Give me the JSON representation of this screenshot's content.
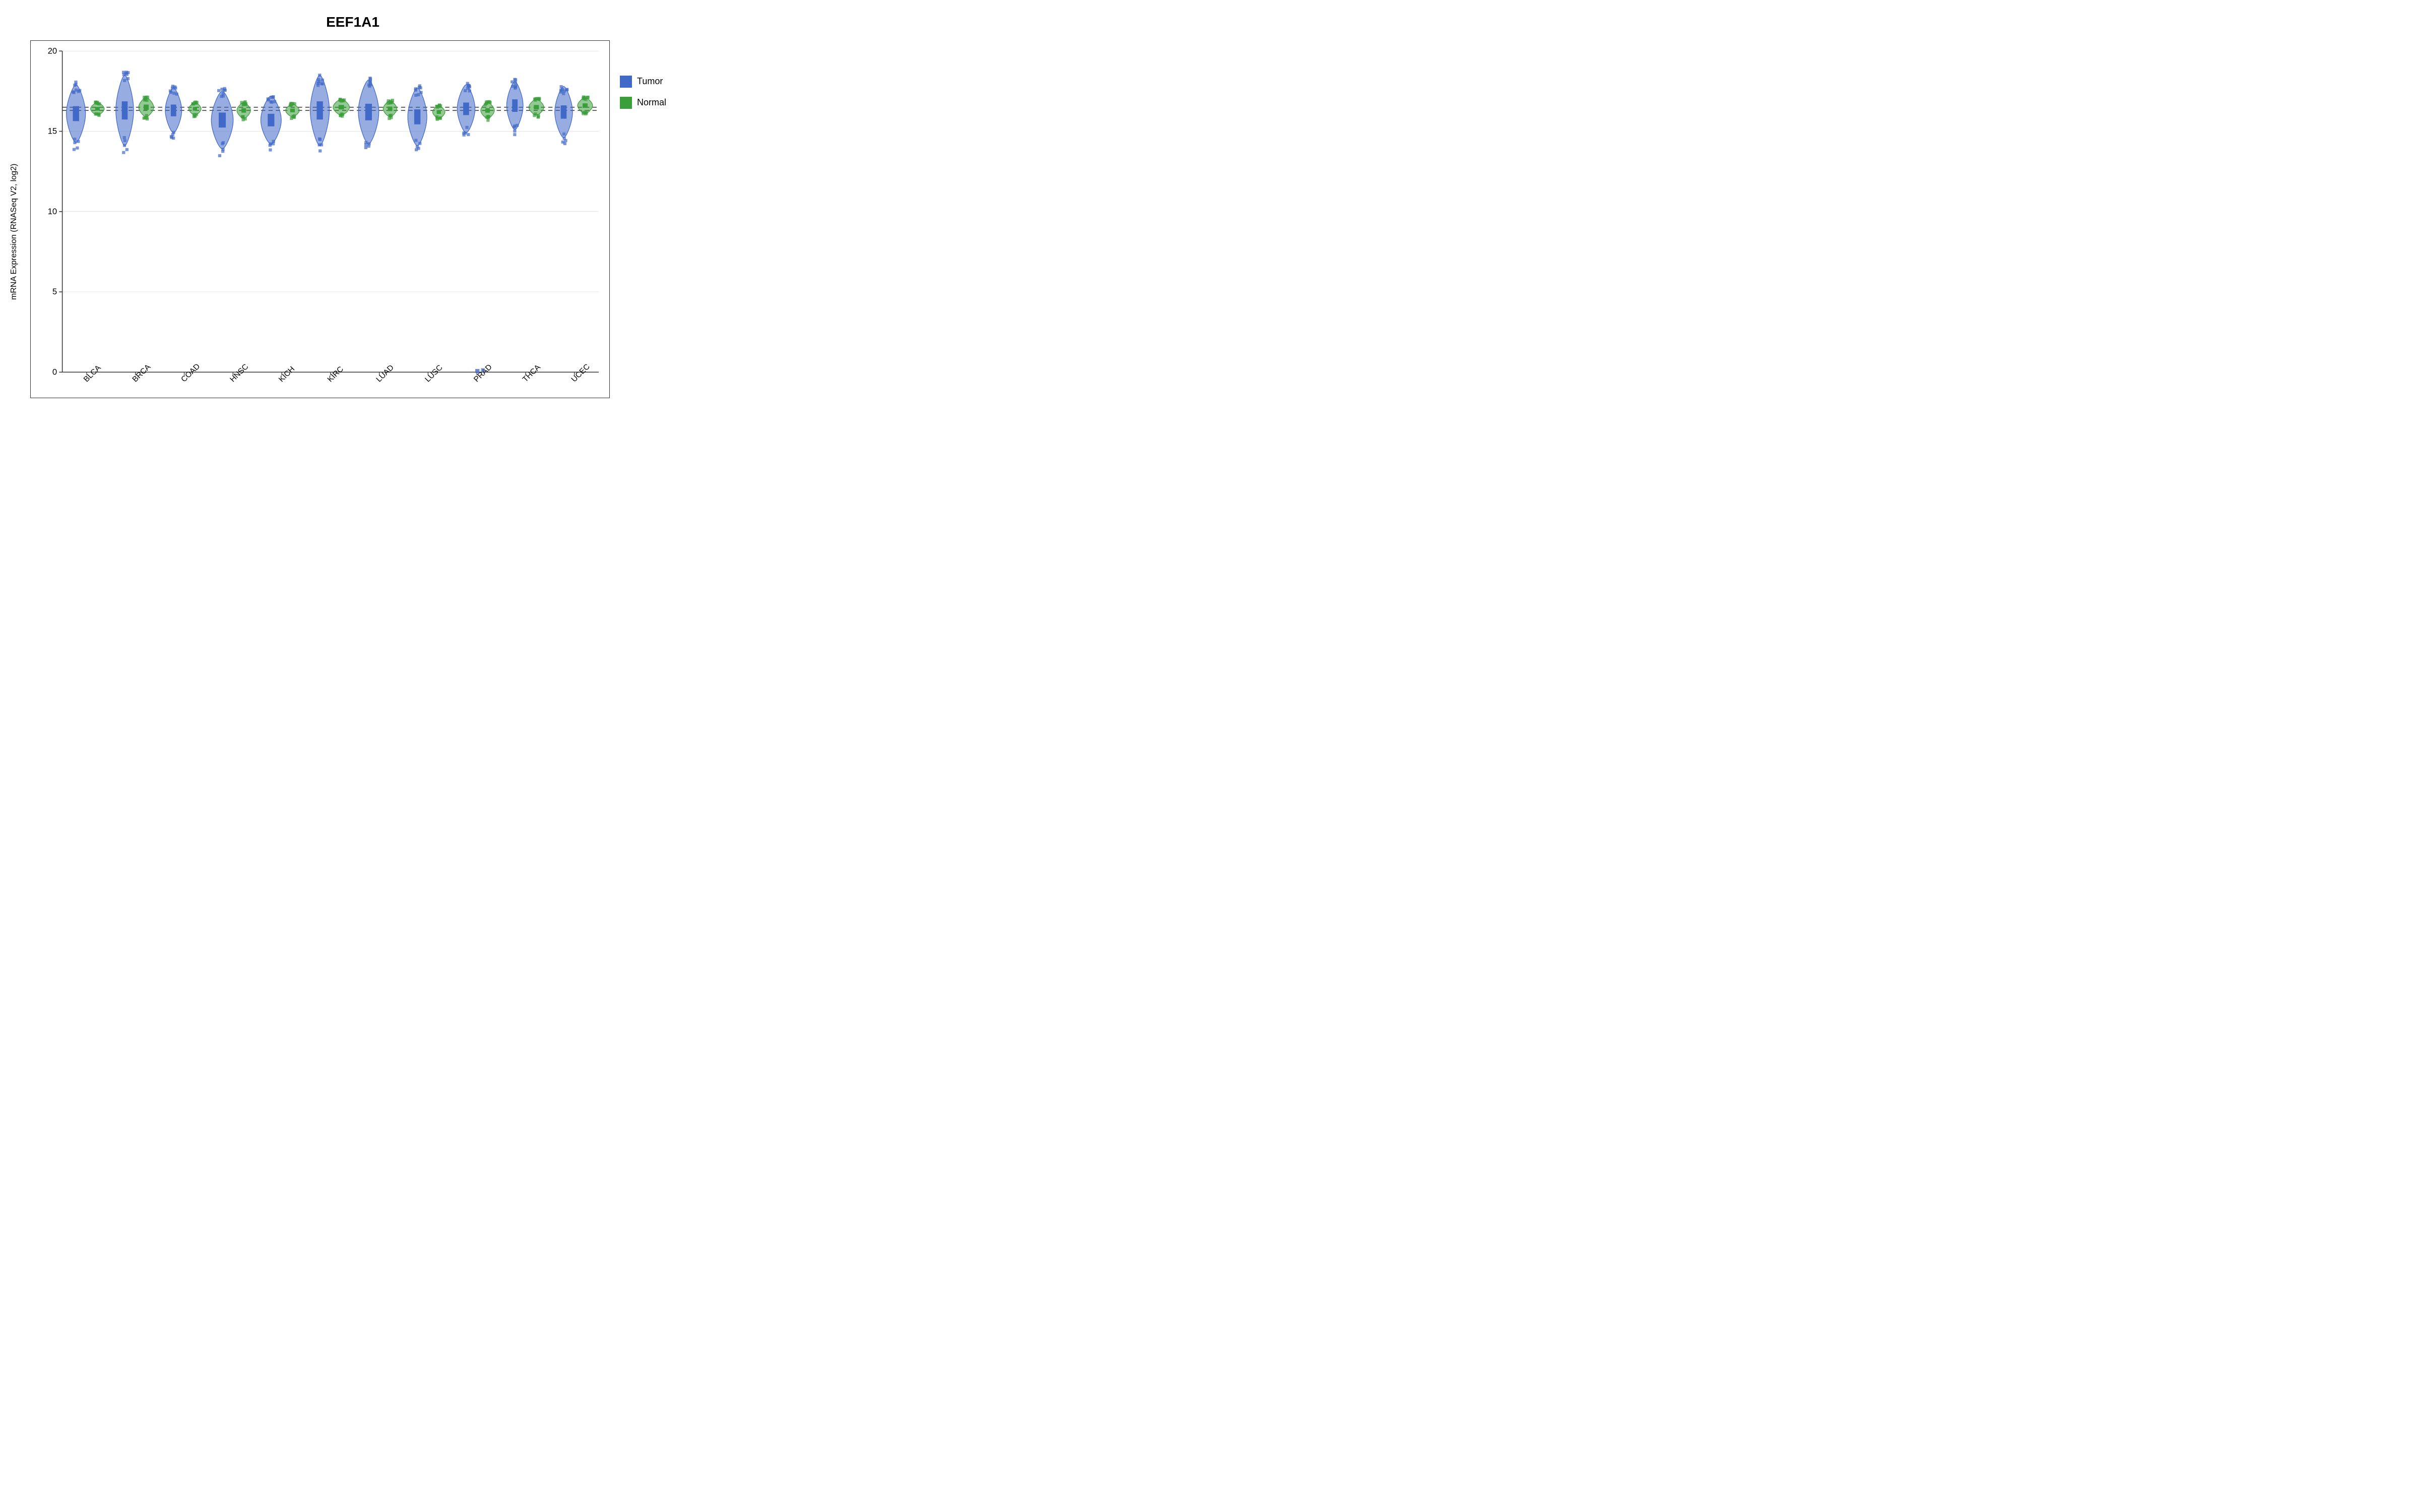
{
  "title": "EEF1A1",
  "yAxisLabel": "mRNA Expression (RNASeq V2, log2)",
  "legend": {
    "items": [
      {
        "label": "Tumor",
        "color": "#4169c8",
        "id": "tumor"
      },
      {
        "label": "Normal",
        "color": "#3a9e3a",
        "id": "normal"
      }
    ]
  },
  "yAxis": {
    "min": 0,
    "max": 20,
    "ticks": [
      0,
      5,
      10,
      15,
      20
    ],
    "labels": [
      "0",
      "5",
      "10",
      "15",
      "20"
    ]
  },
  "cancerTypes": [
    "BLCA",
    "BRCA",
    "COAD",
    "HNSC",
    "KICH",
    "KIRC",
    "LUAD",
    "LUSC",
    "PRAD",
    "THCA",
    "UCEC"
  ],
  "referenceLine1": 16.3,
  "referenceLine2": 16.5,
  "violins": [
    {
      "cancer": "BLCA",
      "tumorCenter": 16.1,
      "tumorWidth": 0.7,
      "tumorSpread": 1.8,
      "normalCenter": 16.4,
      "normalWidth": 0.5,
      "normalSpread": 0.4
    },
    {
      "cancer": "BRCA",
      "tumorCenter": 16.3,
      "tumorWidth": 0.65,
      "tumorSpread": 2.2,
      "normalCenter": 16.5,
      "normalWidth": 0.55,
      "normalSpread": 0.6
    },
    {
      "cancer": "COAD",
      "tumorCenter": 16.3,
      "tumorWidth": 0.6,
      "tumorSpread": 1.4,
      "normalCenter": 16.4,
      "normalWidth": 0.45,
      "normalSpread": 0.4
    },
    {
      "cancer": "HNSC",
      "tumorCenter": 15.7,
      "tumorWidth": 0.8,
      "tumorSpread": 1.8,
      "normalCenter": 16.3,
      "normalWidth": 0.5,
      "normalSpread": 0.5
    },
    {
      "cancer": "KICH",
      "tumorCenter": 15.7,
      "tumorWidth": 0.75,
      "tumorSpread": 1.5,
      "normalCenter": 16.3,
      "normalWidth": 0.5,
      "normalSpread": 0.4
    },
    {
      "cancer": "KIRC",
      "tumorCenter": 16.3,
      "tumorWidth": 0.7,
      "tumorSpread": 2.2,
      "normalCenter": 16.5,
      "normalWidth": 0.6,
      "normalSpread": 0.5
    },
    {
      "cancer": "LUAD",
      "tumorCenter": 16.2,
      "tumorWidth": 0.75,
      "tumorSpread": 2.0,
      "normalCenter": 16.4,
      "normalWidth": 0.5,
      "normalSpread": 0.5
    },
    {
      "cancer": "LUSC",
      "tumorCenter": 15.9,
      "tumorWidth": 0.7,
      "tumorSpread": 1.8,
      "normalCenter": 16.2,
      "normalWidth": 0.45,
      "normalSpread": 0.4
    },
    {
      "cancer": "PRAD",
      "tumorCenter": 16.4,
      "tumorWidth": 0.65,
      "tumorSpread": 1.5,
      "normalCenter": 16.3,
      "normalWidth": 0.5,
      "normalSpread": 0.5
    },
    {
      "cancer": "THCA",
      "tumorCenter": 16.6,
      "tumorWidth": 0.6,
      "tumorSpread": 1.5,
      "normalCenter": 16.5,
      "normalWidth": 0.55,
      "normalSpread": 0.5
    },
    {
      "cancer": "UCEC",
      "tumorCenter": 16.2,
      "tumorWidth": 0.65,
      "tumorSpread": 1.6,
      "normalCenter": 16.6,
      "normalWidth": 0.55,
      "normalSpread": 0.5
    }
  ]
}
